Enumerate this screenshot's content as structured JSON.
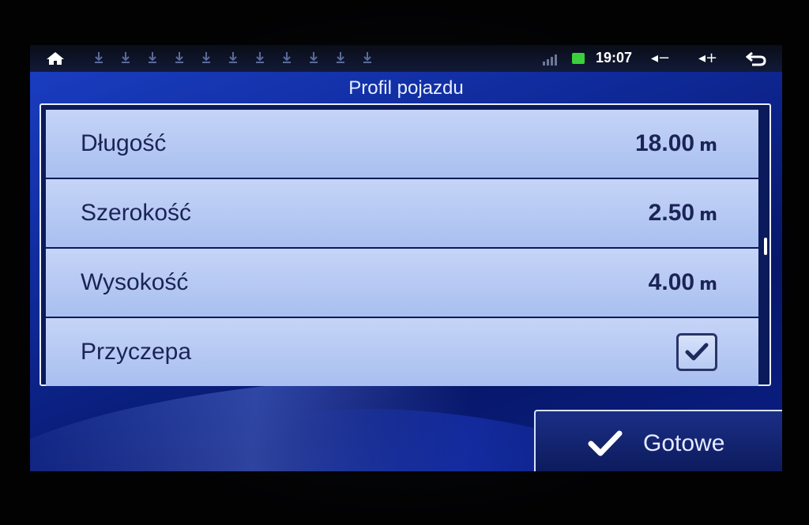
{
  "status_bar": {
    "time": "19:07",
    "vol_down_label": "◂−",
    "vol_up_label": "◂+",
    "notification_count": 11
  },
  "header": {
    "title": "Profil pojazdu"
  },
  "vehicle_profile": {
    "rows": [
      {
        "label": "Długość",
        "value": "18.00",
        "unit": "m"
      },
      {
        "label": "Szerokość",
        "value": "2.50",
        "unit": "m"
      },
      {
        "label": "Wysokość",
        "value": "4.00",
        "unit": "m"
      },
      {
        "label": "Przyczepa",
        "checked": true
      }
    ]
  },
  "footer": {
    "done_label": "Gotowe"
  },
  "colors": {
    "screen_bg": "#1b3fc4",
    "row_bg": "#b9cbf3",
    "text_dark": "#1b2456",
    "battery": "#3bcf3b"
  }
}
